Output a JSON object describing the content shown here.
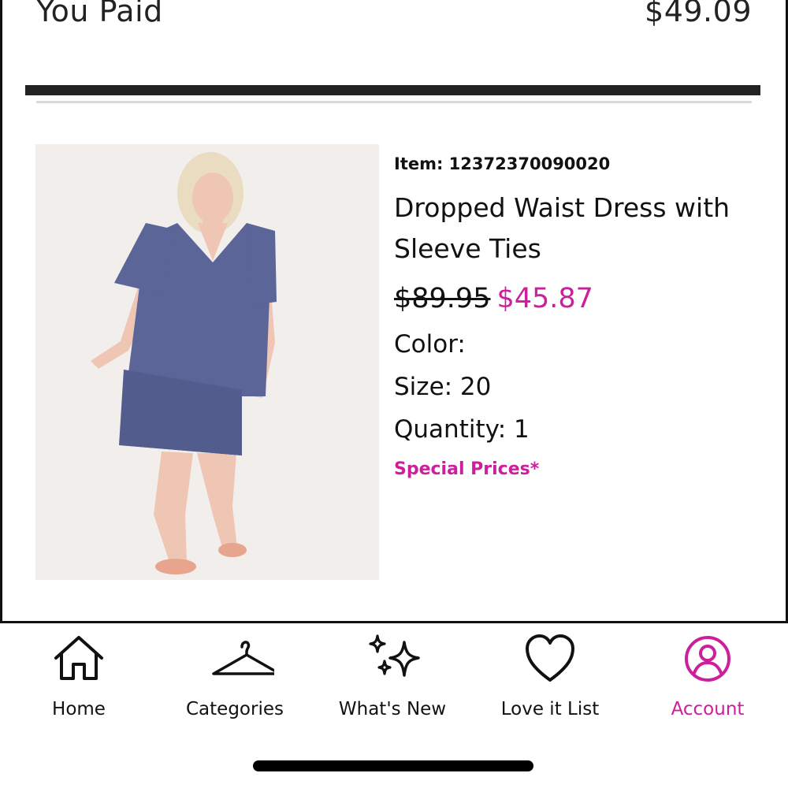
{
  "order_summary": {
    "paid_label": "You Paid",
    "paid_amount": "$49.09"
  },
  "product": {
    "item_number": "Item: 12372370090020",
    "name": "Dropped Waist Dress with Sleeve Ties",
    "original_price": "$89.95",
    "sale_price": "$45.87",
    "color_label": "Color:",
    "size_label": "Size: 20",
    "quantity_label": "Quantity: 1",
    "special_prices": "Special Prices*"
  },
  "colors": {
    "accent": "#cc1f9c",
    "dress": "#5b6597",
    "text": "#111111"
  },
  "bottom_nav": {
    "items": [
      {
        "label": "Home",
        "icon": "home-icon",
        "active": false
      },
      {
        "label": "Categories",
        "icon": "hanger-icon",
        "active": false
      },
      {
        "label": "What's New",
        "icon": "sparkles-icon",
        "active": false
      },
      {
        "label": "Love it List",
        "icon": "heart-icon",
        "active": false
      },
      {
        "label": "Account",
        "icon": "account-icon",
        "active": true
      }
    ]
  }
}
